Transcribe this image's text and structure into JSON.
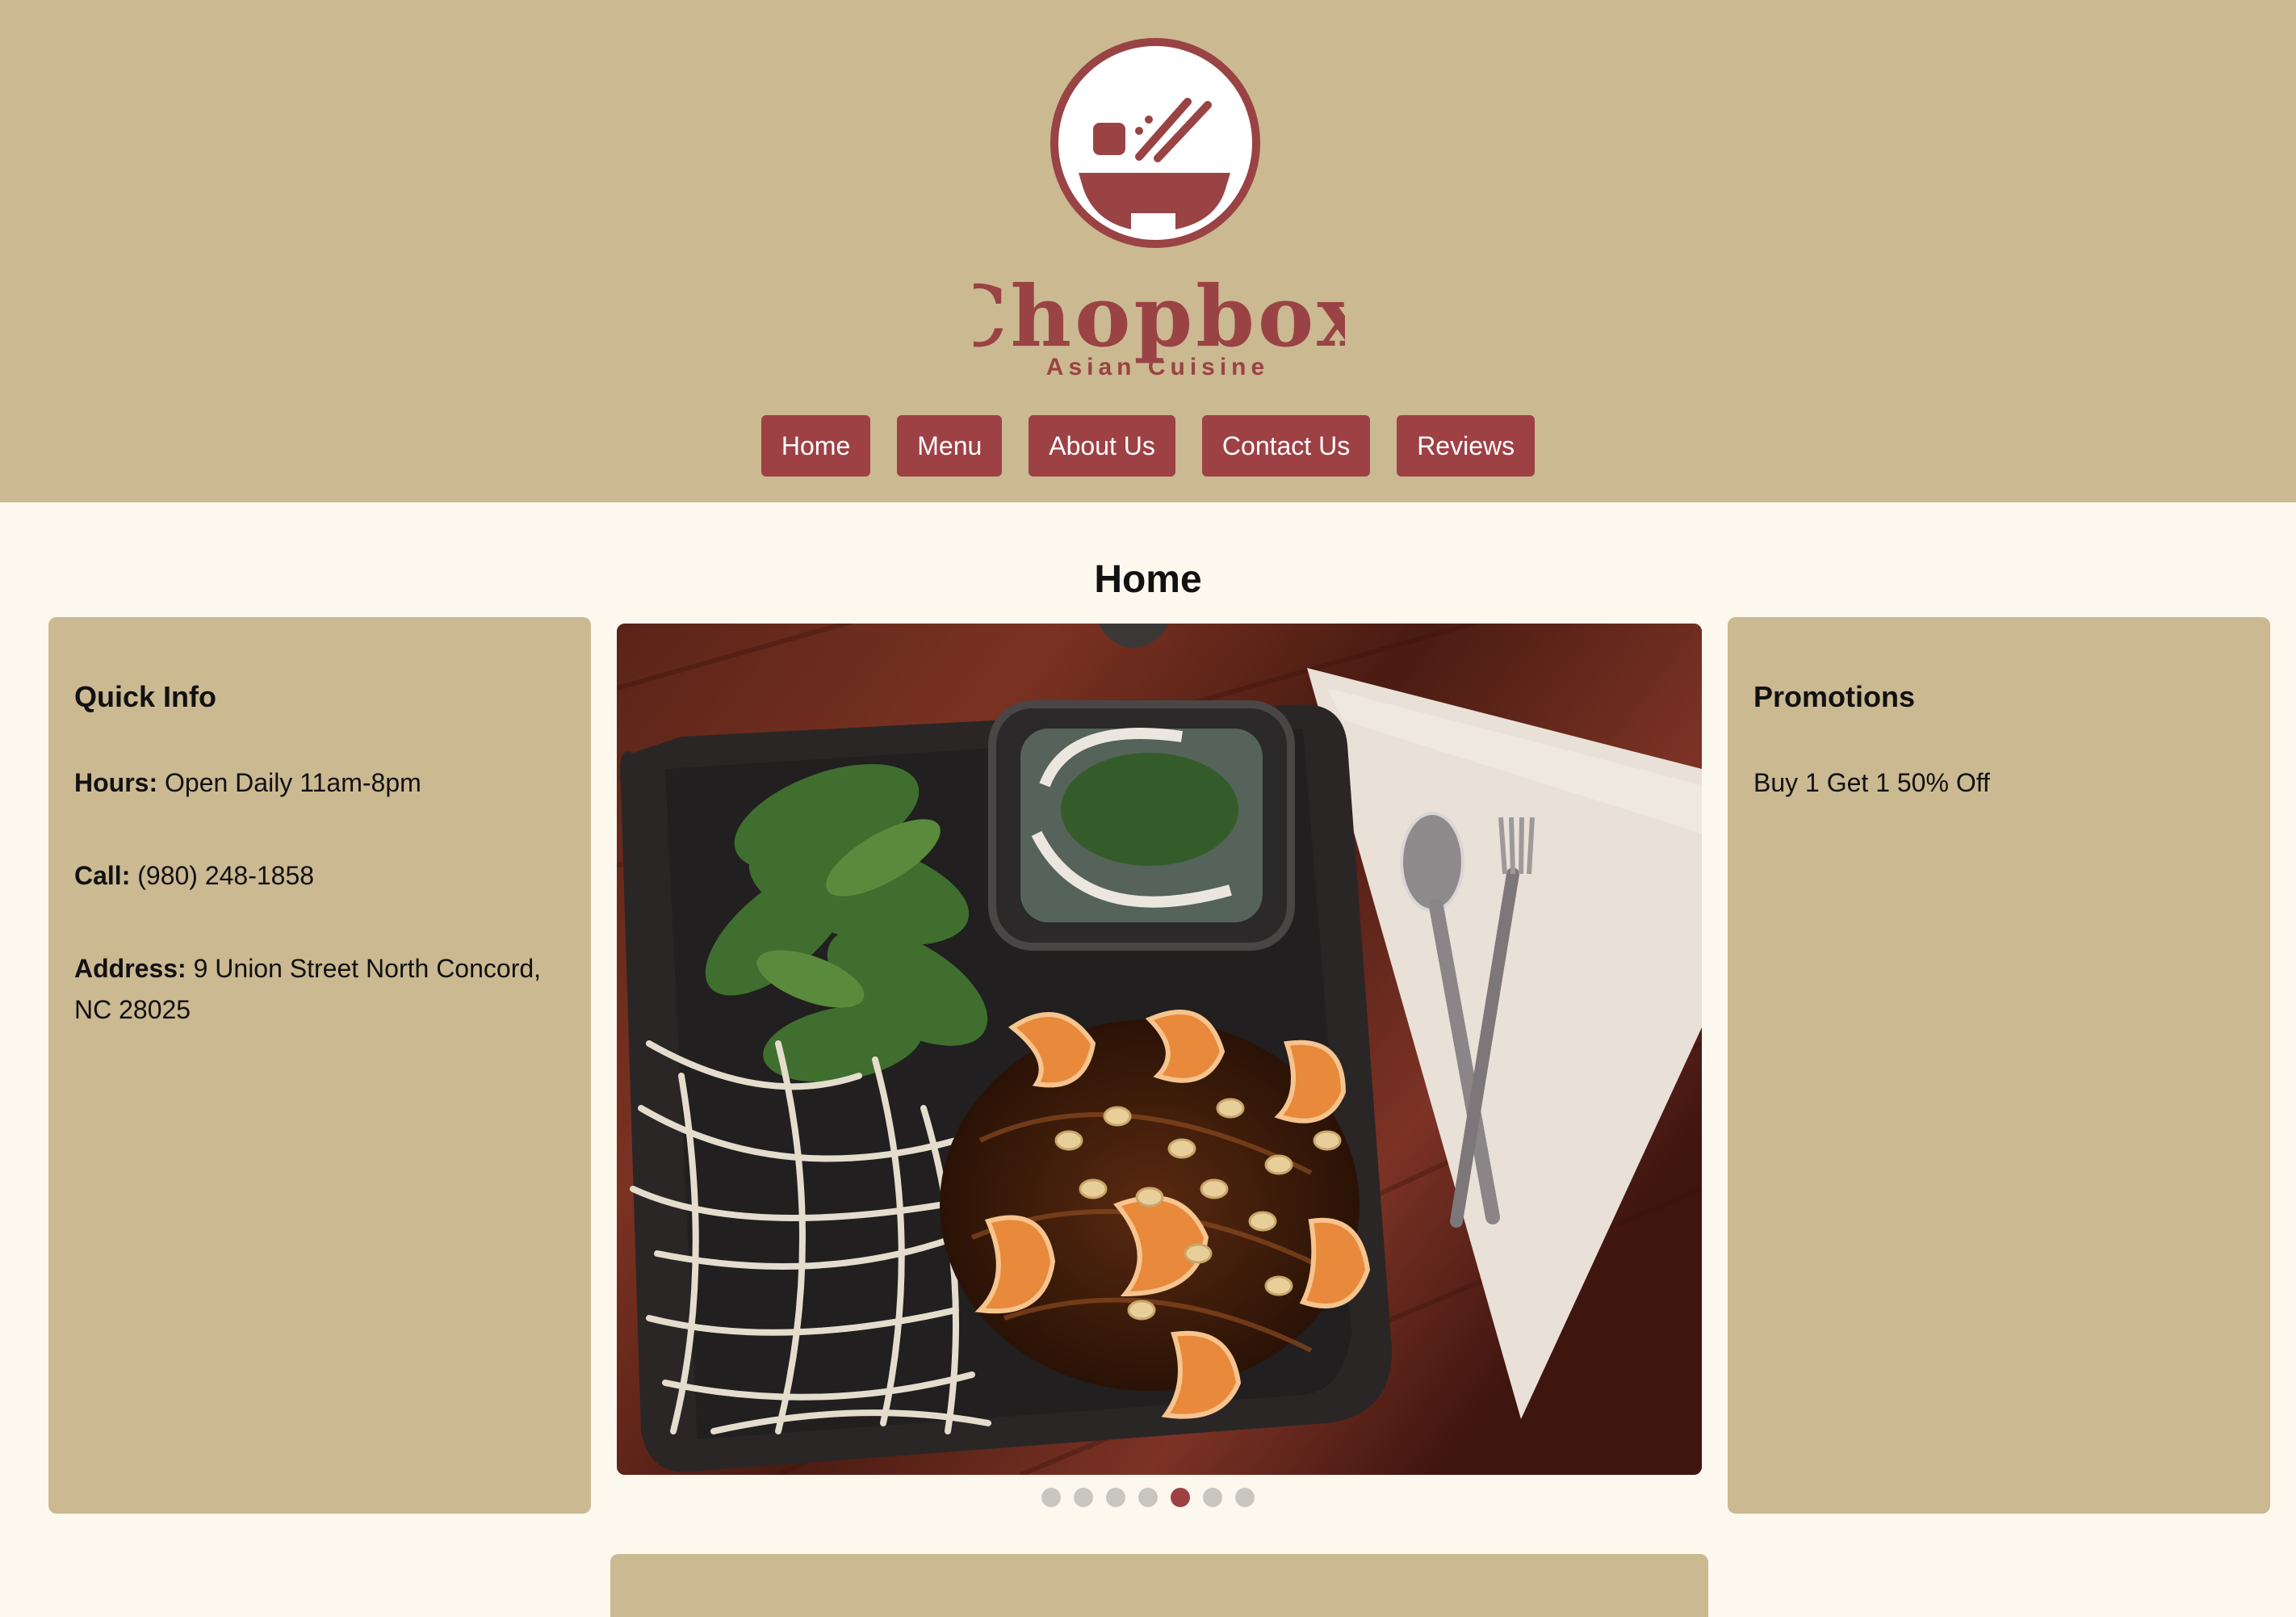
{
  "header": {
    "logo": {
      "brand": "Chopbox",
      "tagline": "Asian Cuisine"
    },
    "nav": [
      {
        "label": "Home"
      },
      {
        "label": "Menu"
      },
      {
        "label": "About Us"
      },
      {
        "label": "Contact Us"
      },
      {
        "label": "Reviews"
      }
    ]
  },
  "main": {
    "title": "Home",
    "quick_info": {
      "heading": "Quick Info",
      "hours_label": "Hours:",
      "hours_value": " Open Daily 11am-8pm",
      "call_label": "Call:",
      "call_value": " (980) 248-1858",
      "address_label": "Address:",
      "address_value": " 9 Union Street North Concord, NC 28025"
    },
    "promotions": {
      "heading": "Promotions",
      "text": "Buy 1 Get 1 50% Off"
    },
    "carousel": {
      "image": "shrimp-noodle-dish-photo",
      "slide_count": 7,
      "active_slide": 5
    }
  },
  "colors": {
    "header_bg": "#cbb992",
    "page_bg": "#fdf8ee",
    "accent": "#9e4145",
    "dot_inactive": "#c9c6c1"
  }
}
